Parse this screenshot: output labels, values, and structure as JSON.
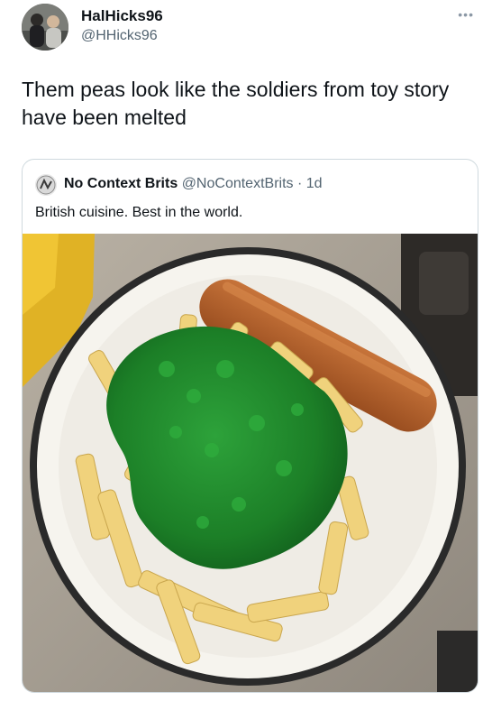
{
  "tweet": {
    "author_name": "HalHicks96",
    "author_handle": "@HHicks96",
    "more_icon": "more-icon",
    "text": "Them peas look like the soldiers from toy story have been melted"
  },
  "quoted_tweet": {
    "author_name": "No Context Brits",
    "author_handle": "@NoContextBrits",
    "separator": "·",
    "time": "1d",
    "text": "British cuisine. Best in the world."
  },
  "colors": {
    "peas": "#1f8a2a",
    "chips": "#f1d27a",
    "plate": "#f7f5ef",
    "plate_rim": "#2a2a2a",
    "sausage": "#b5622a"
  }
}
